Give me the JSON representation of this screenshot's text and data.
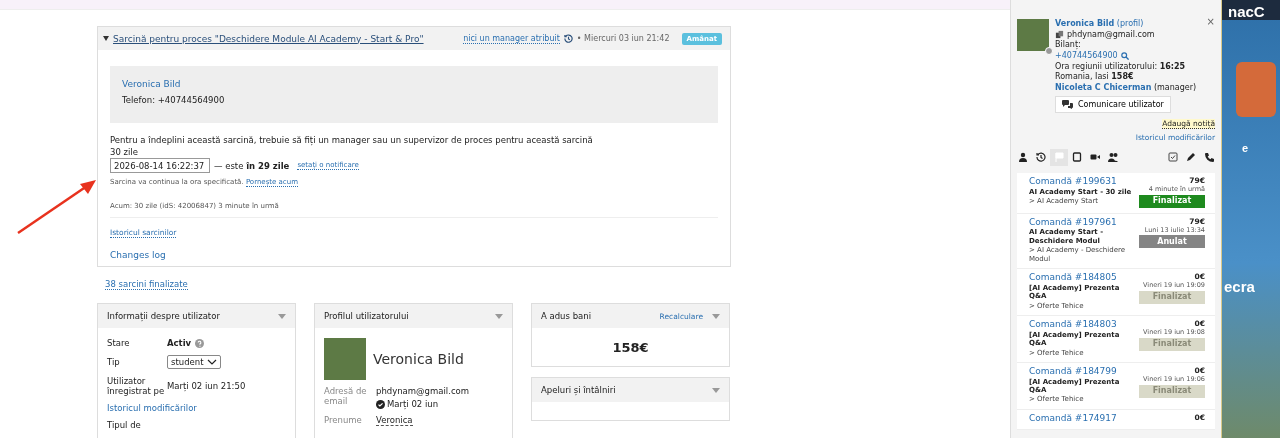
{
  "task": {
    "title": "Sarcină pentru proces \"Deschidere Module AI Academy - Start & Pro\"",
    "expanded": true,
    "manager": "nici un manager atribuit",
    "date": "• Miercuri 03 iun 21:42",
    "status": "Amânat",
    "contact_name": "Veronica Bild",
    "contact_phone": "Telefon: +40744564900",
    "notice": "Pentru a îndeplini această sarcină, trebuie să fiți un manager sau un supervizor de proces pentru această sarcină",
    "duration": "30 zile",
    "datetime_value": "2026-08-14 16:22:37",
    "relative": "— este **în 29 zile**",
    "notify_link": "setați o notificare",
    "continue_note": "Sarcina va continua la ora specificată.",
    "start_link": "Pornește acum",
    "current": "Acum: 30 zile (idS: 42006847) 3 minute în urmă",
    "history_link": "Istoricul sarcinilor",
    "changes_link": "Changes log"
  },
  "finished_link": "38 sarcini finalizate",
  "user_info": {
    "title": "Informații despre utilizator",
    "status_label": "Stare",
    "status_value": "Activ",
    "type_label": "Tip",
    "type_value": "student",
    "registered_label": "Utilizator înregistrat pe",
    "registered_value": "Marți 02 iun 21:50",
    "history_link": "Istoricul modificărilor",
    "next_label": "Tipul de"
  },
  "user_profile": {
    "title": "Profilul utilizatorului",
    "name": "Veronica Bild",
    "email_label": "Adresă de email",
    "email": "phdynam@gmail.com",
    "email_date": "Marți 02 iun",
    "first_name_label": "Prenume",
    "first_name": "Veronica"
  },
  "revenue": {
    "title": "A adus bani",
    "recalc_link": "Recalculare",
    "amount": "158€"
  },
  "calls": {
    "title": "Apeluri și întâlniri"
  },
  "side_panel": {
    "name": "Veronica Bild",
    "profile_link": "(profil)",
    "email": "phdynam@gmail.com",
    "online": false,
    "close": "×",
    "balance_label": "Bilanț:",
    "phone": "+40744564900",
    "region_time": "Ora regiunii utilizatorului: **16:25**",
    "location": "Romania, Iasi **158€**",
    "manager_name": "Nicoleta C Chicerman",
    "manager_role": "(manager)",
    "contact_button": "Comunicare utilizator",
    "add_note": "Adaugă notiță",
    "history_link": "Istoricul modificărilor",
    "tabs": [
      {
        "kind": "user",
        "selected": false
      },
      {
        "kind": "history",
        "selected": false
      },
      {
        "kind": "flag",
        "selected": true
      },
      {
        "kind": "book",
        "selected": false
      },
      {
        "kind": "video",
        "selected": false
      },
      {
        "kind": "group",
        "selected": false
      },
      {
        "kind": "task",
        "selected": false
      },
      {
        "kind": "edit",
        "selected": false
      },
      {
        "kind": "phone",
        "selected": false
      }
    ],
    "orders": [
      {
        "number": "Comandă #199631",
        "title": "AI Academy Start - 30 zile",
        "category": "> AI Academy Start",
        "price": "79€",
        "date": "4 minute în urmă",
        "status": "Finalizat",
        "color": "#1e8a1e"
      },
      {
        "number": "Comandă #197961",
        "title": "AI Academy Start - Deschidere Modul",
        "category": "> AI Academy - Deschidere Modul",
        "price": "79€",
        "date": "Luni 13 iulie 13:34",
        "status": "Anulat",
        "color": "#858585"
      },
      {
        "number": "Comandă #184805",
        "title": "[AI Academy] Prezenta Q&A",
        "category": "> Oferte Tehice",
        "price": "0€",
        "date": "Vineri 19 iun 19:09",
        "status": "Finalizat",
        "color": "#d9d9c8"
      },
      {
        "number": "Comandă #184803",
        "title": "[AI Academy] Prezenta Q&A",
        "category": "> Oferte Tehice",
        "price": "0€",
        "date": "Vineri 19 iun 19:08",
        "status": "Finalizat",
        "color": "#d9d9c8"
      },
      {
        "number": "Comandă #184799",
        "title": "[AI Academy] Prezenta Q&A",
        "category": "> Oferte Tehice",
        "price": "0€",
        "date": "Vineri 19 iun 19:06",
        "status": "Finalizat",
        "color": "#d9d9c8"
      },
      {
        "number": "Comandă #174917",
        "price": "0€"
      }
    ]
  },
  "background_page": {
    "texts": [
      "nacC",
      "e",
      "ecra"
    ]
  }
}
